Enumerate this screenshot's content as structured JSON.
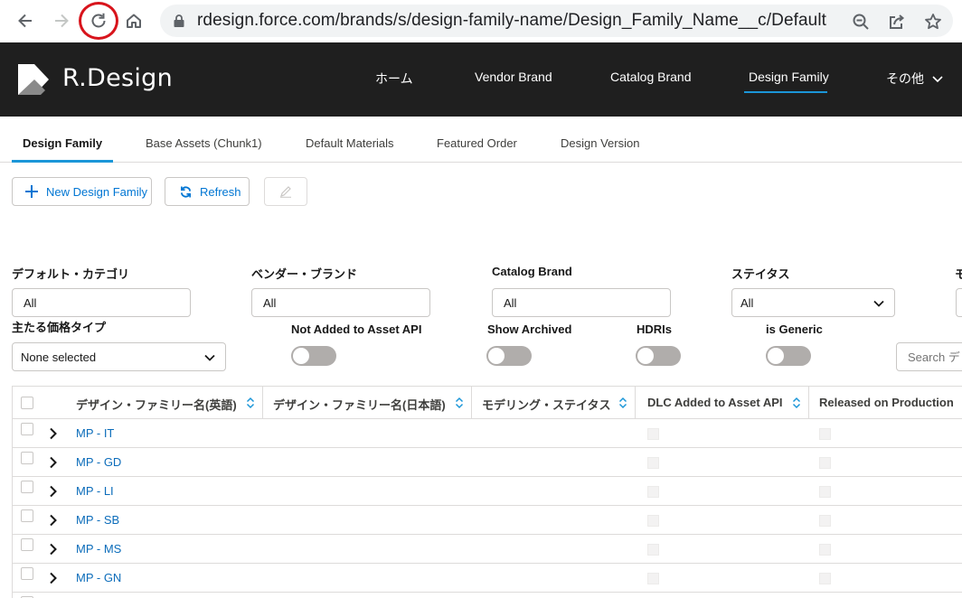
{
  "browser": {
    "url": "rdesign.force.com/brands/s/design-family-name/Design_Family_Name__c/Default"
  },
  "app": {
    "brand": "R.Design",
    "nav": [
      "ホーム",
      "Vendor Brand",
      "Catalog Brand",
      "Design Family",
      "その他"
    ],
    "active_nav": "Design Family"
  },
  "subtabs": [
    "Design Family",
    "Base Assets (Chunk1)",
    "Default Materials",
    "Featured Order",
    "Design Version"
  ],
  "active_subtab": "Design Family",
  "toolbar": {
    "new_label": "New Design Family",
    "refresh_label": "Refresh"
  },
  "filters": {
    "default_category": {
      "label": "デフォルト・カテゴリ",
      "value": "All"
    },
    "vendor_brand": {
      "label": "ベンダー・ブランド",
      "value": "All"
    },
    "catalog_brand": {
      "label": "Catalog Brand",
      "value": "All"
    },
    "status": {
      "label": "ステイタス",
      "value": "All"
    },
    "extra_label": "モ",
    "price_type": {
      "label": "主たる価格タイプ",
      "value": "None selected"
    },
    "toggles": [
      {
        "label": "Not Added to Asset API",
        "on": false
      },
      {
        "label": "Show Archived",
        "on": false
      },
      {
        "label": "HDRIs",
        "on": false
      },
      {
        "label": "is Generic",
        "on": false
      }
    ],
    "search_placeholder": "Search デ"
  },
  "table": {
    "columns": [
      "デザイン・ファミリー名(英語)",
      "デザイン・ファミリー名(日本語)",
      "モデリング・ステイタス",
      "DLC Added to Asset API",
      "Released on Production"
    ],
    "rows": [
      {
        "name": "MP - IT"
      },
      {
        "name": "MP - GD"
      },
      {
        "name": "MP - LI"
      },
      {
        "name": "MP - SB"
      },
      {
        "name": "MP - MS"
      },
      {
        "name": "MP - GN"
      }
    ]
  },
  "colors": {
    "header_bg": "#1f1f1f",
    "accent": "#1b96d8",
    "link": "#0b6cba",
    "highlight_ring": "#d8141c"
  }
}
